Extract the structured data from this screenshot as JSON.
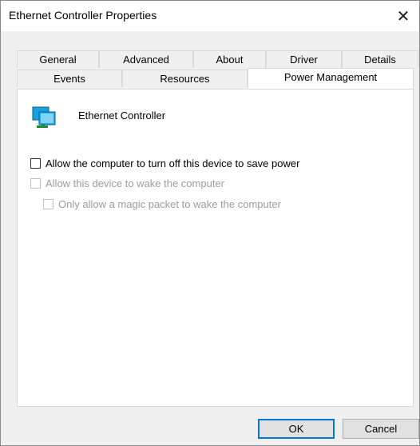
{
  "window": {
    "title": "Ethernet Controller Properties",
    "close_glyph": "✕"
  },
  "tabs": {
    "row1": [
      "General",
      "Advanced",
      "About",
      "Driver",
      "Details"
    ],
    "row2": [
      "Events",
      "Resources",
      "Power Management"
    ],
    "active": "Power Management"
  },
  "device": {
    "name": "Ethernet Controller",
    "icon": "network-adapter-icon"
  },
  "options": [
    {
      "label": "Allow the computer to turn off this device to save power",
      "checked": false,
      "enabled": true
    },
    {
      "label": "Allow this device to wake the computer",
      "checked": false,
      "enabled": false
    },
    {
      "label": "Only allow a magic packet to wake the computer",
      "checked": false,
      "enabled": false
    }
  ],
  "buttons": {
    "ok": "OK",
    "cancel": "Cancel"
  },
  "colors": {
    "accent": "#0078d7",
    "disabled_text": "#9c9c9c"
  }
}
